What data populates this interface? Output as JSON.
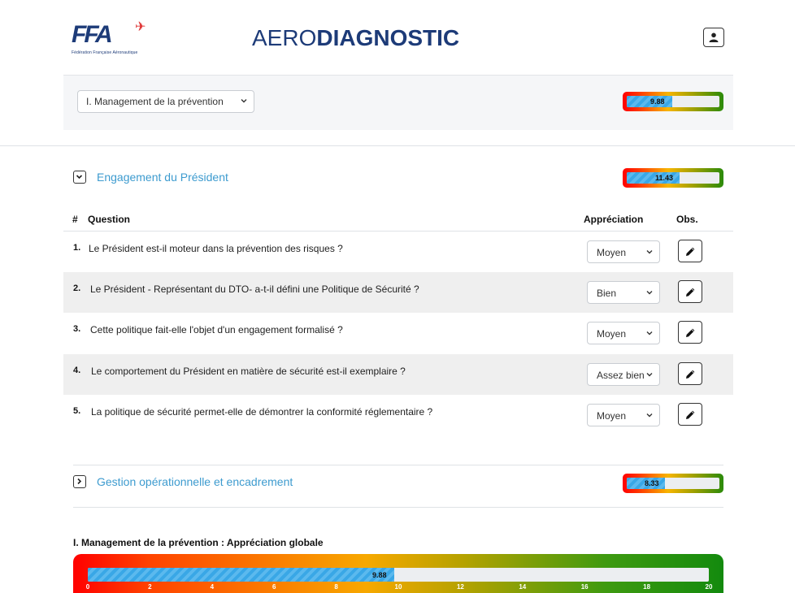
{
  "header": {
    "logo_text": "FFA",
    "logo_subtitle": "Fédération Française Aéronautique",
    "title_prefix": "AERO",
    "title_bold": "DIAGNOSTIC"
  },
  "section_select": {
    "selected": "I. Management de la prévention"
  },
  "section_score": {
    "value": 9.88,
    "label": "9.88",
    "max": 20
  },
  "groups": [
    {
      "title": "Engagement du Président",
      "score_label": "11.43",
      "score": 11.43,
      "expanded": true
    },
    {
      "title": "Gestion opérationnelle et encadrement",
      "score_label": "8.33",
      "score": 8.33,
      "expanded": false
    }
  ],
  "table": {
    "headers": {
      "num": "#",
      "question": "Question",
      "appreciation": "Appréciation",
      "obs": "Obs."
    },
    "rows": [
      {
        "num": "1.",
        "question": "Le Président est-il moteur dans la prévention des risques ?",
        "appreciation": "Moyen"
      },
      {
        "num": "2.",
        "question": "Le Président - Représentant du DTO- a-t-il défini une Politique de Sécurité ?",
        "appreciation": "Bien"
      },
      {
        "num": "3.",
        "question": "Cette politique fait-elle l'objet d'un engagement formalisé ?",
        "appreciation": "Moyen"
      },
      {
        "num": "4.",
        "question": "Le comportement du Président en matière de sécurité est-il exemplaire ?",
        "appreciation": "Assez bien"
      },
      {
        "num": "5.",
        "question": "La politique de sécurité permet-elle de démontrer la conformité réglementaire ?",
        "appreciation": "Moyen"
      }
    ]
  },
  "global": {
    "label": "I. Management de la prévention : Appréciation globale",
    "value": 9.88,
    "value_label": "9.88",
    "ticks": [
      "0",
      "2",
      "4",
      "6",
      "8",
      "10",
      "12",
      "14",
      "16",
      "18",
      "20"
    ]
  },
  "colors": {
    "title": "#1d3b78",
    "group_title": "#3d9bcf",
    "fill": "#39a7e6",
    "logo_accent": "#e03535"
  },
  "icons": {
    "user": "user-icon",
    "edit": "pencil-icon",
    "expand": "chevron-down-icon",
    "collapse": "chevron-right-icon"
  }
}
